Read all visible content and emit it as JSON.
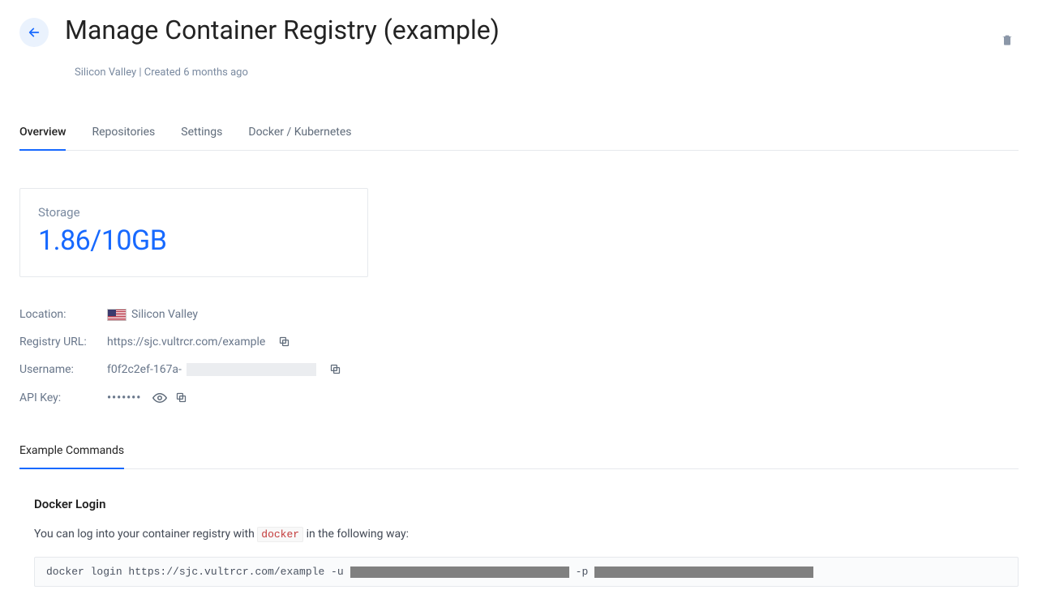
{
  "header": {
    "title": "Manage Container Registry (example)",
    "subtitle": "Silicon Valley | Created 6 months ago"
  },
  "tabs": {
    "overview": "Overview",
    "repositories": "Repositories",
    "settings": "Settings",
    "docker_k8s": "Docker / Kubernetes"
  },
  "storage": {
    "label": "Storage",
    "value": "1.86/10GB"
  },
  "kv": {
    "location_label": "Location:",
    "location_value": "Silicon Valley",
    "registry_url_label": "Registry URL:",
    "registry_url_value": "https://sjc.vultrcr.com/example",
    "username_label": "Username:",
    "username_prefix": "f0f2c2ef-167a-",
    "api_key_label": "API Key:",
    "api_key_masked": "•••••••"
  },
  "subtabs": {
    "example_commands": "Example Commands"
  },
  "docker_login": {
    "heading": "Docker Login",
    "desc_pre": "You can log into your container registry with ",
    "desc_code": "docker",
    "desc_post": " in the following way:",
    "command_prefix": "docker login https://sjc.vultrcr.com/example -u ",
    "command_pflag": " -p "
  }
}
